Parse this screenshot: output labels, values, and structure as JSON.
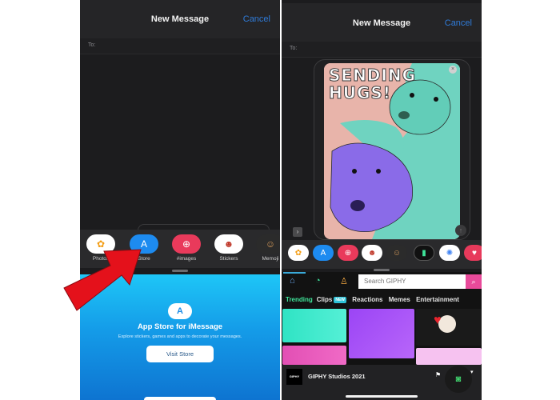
{
  "left_phone": {
    "nav": {
      "title": "New Message",
      "cancel_label": "Cancel"
    },
    "to_label": "To:",
    "apps": [
      {
        "label": "Photos",
        "icon": "photos-icon",
        "color": "#ffffff"
      },
      {
        "label": "Store",
        "icon": "app-store-icon",
        "color": "#1d8bf0"
      },
      {
        "label": "#images",
        "icon": "images-search-icon",
        "color": "#e93a5b"
      },
      {
        "label": "Stickers",
        "icon": "stickers-icon",
        "color": "#ffffff"
      },
      {
        "label": "Memoji",
        "icon": "memoji-icon",
        "color": "#2b2b2b"
      }
    ],
    "store_panel": {
      "title": "App Store for iMessage",
      "subtitle": "Explore stickers, games and apps to decorate your messages.",
      "button_label": "Visit Store"
    }
  },
  "right_phone": {
    "nav": {
      "title": "New Message",
      "cancel_label": "Cancel"
    },
    "to_label": "To:",
    "sticker": {
      "text_line1": "SENDING",
      "text_line2": "HUGS!"
    },
    "apps": [
      {
        "icon": "photos-icon",
        "color": "#ffffff"
      },
      {
        "icon": "app-store-icon",
        "color": "#1d8bf0"
      },
      {
        "icon": "images-search-icon",
        "color": "#e93a5b"
      },
      {
        "icon": "stickers-icon",
        "color": "#ffffff"
      },
      {
        "icon": "memoji-icon",
        "color": "#2b2b2b"
      },
      {
        "icon": "giphy-icon",
        "color": "#111111"
      },
      {
        "icon": "google-photos-icon",
        "color": "#ffffff"
      },
      {
        "icon": "heart-app-icon",
        "color": "#e73a5b"
      }
    ],
    "giphy": {
      "search_placeholder": "Search GIPHY",
      "categories": [
        "Trending",
        "Clips",
        "Reactions",
        "Memes",
        "Entertainment"
      ],
      "new_badge": "NEW",
      "channel_name": "GIPHY Studios 2021",
      "logo_text": "GIPHY",
      "tile_colors": [
        "#3ee6c8",
        "#9b45f5",
        "#1a1a1a",
        "#e856b9",
        "#f6c2f0"
      ]
    }
  },
  "annotation": {
    "arrow_color": "#e4111b"
  }
}
